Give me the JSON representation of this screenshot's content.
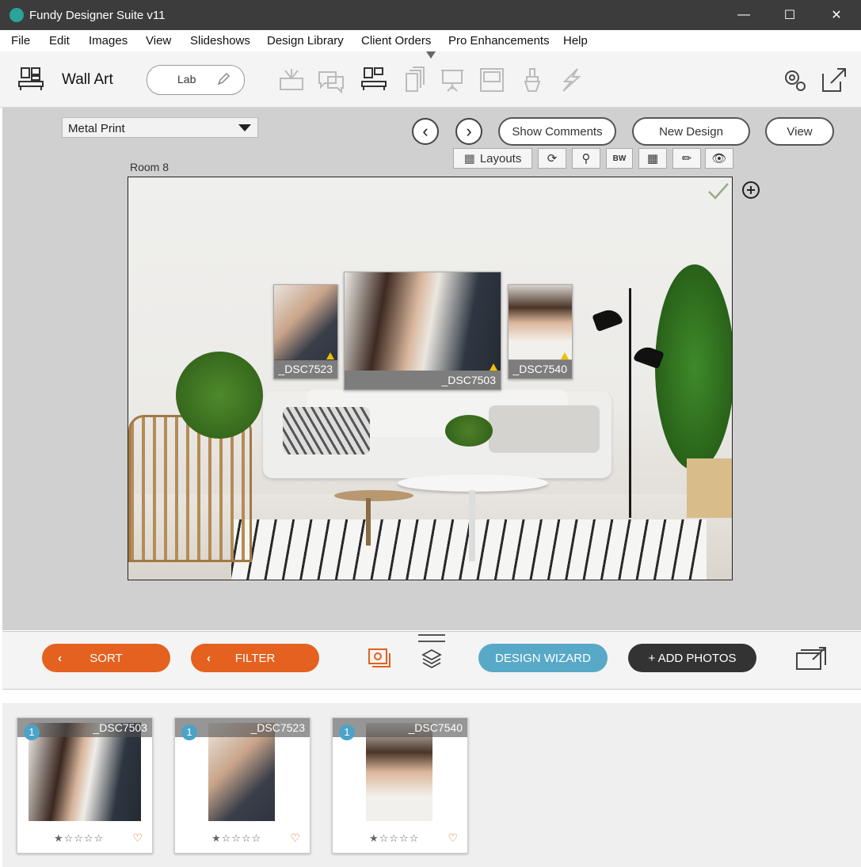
{
  "window": {
    "title": "Fundy Designer Suite v11"
  },
  "menu": [
    "File",
    "Edit",
    "Images",
    "View",
    "Slideshows",
    "Design Library",
    "Client Orders",
    "Pro Enhancements",
    "Help"
  ],
  "toolbar": {
    "module_title": "Wall Art",
    "lab_label": "Lab"
  },
  "workspace": {
    "product_select": "Metal Print",
    "room_label": "Room 8",
    "show_comments": "Show Comments",
    "new_design": "New Design",
    "view": "View",
    "layouts": "Layouts",
    "bw": "BW"
  },
  "frames": [
    {
      "name": "_DSC7523"
    },
    {
      "name": "_DSC7503"
    },
    {
      "name": "_DSC7540"
    }
  ],
  "bottom": {
    "sort": "SORT",
    "filter": "FILTER",
    "design_wizard": "DESIGN WIZARD",
    "add_photos": "+ ADD PHOTOS"
  },
  "tray": [
    {
      "name": "_DSC7503",
      "count": "1",
      "stars": "★☆☆☆☆",
      "heart": "♡"
    },
    {
      "name": "_DSC7523",
      "count": "1",
      "stars": "★☆☆☆☆",
      "heart": "♡"
    },
    {
      "name": "_DSC7540",
      "count": "1",
      "stars": "★☆☆☆☆",
      "heart": "♡"
    }
  ],
  "colors": {
    "accent_orange": "#e4611f",
    "accent_teal": "#58a9c7",
    "titlebar": "#3c3c3c"
  }
}
